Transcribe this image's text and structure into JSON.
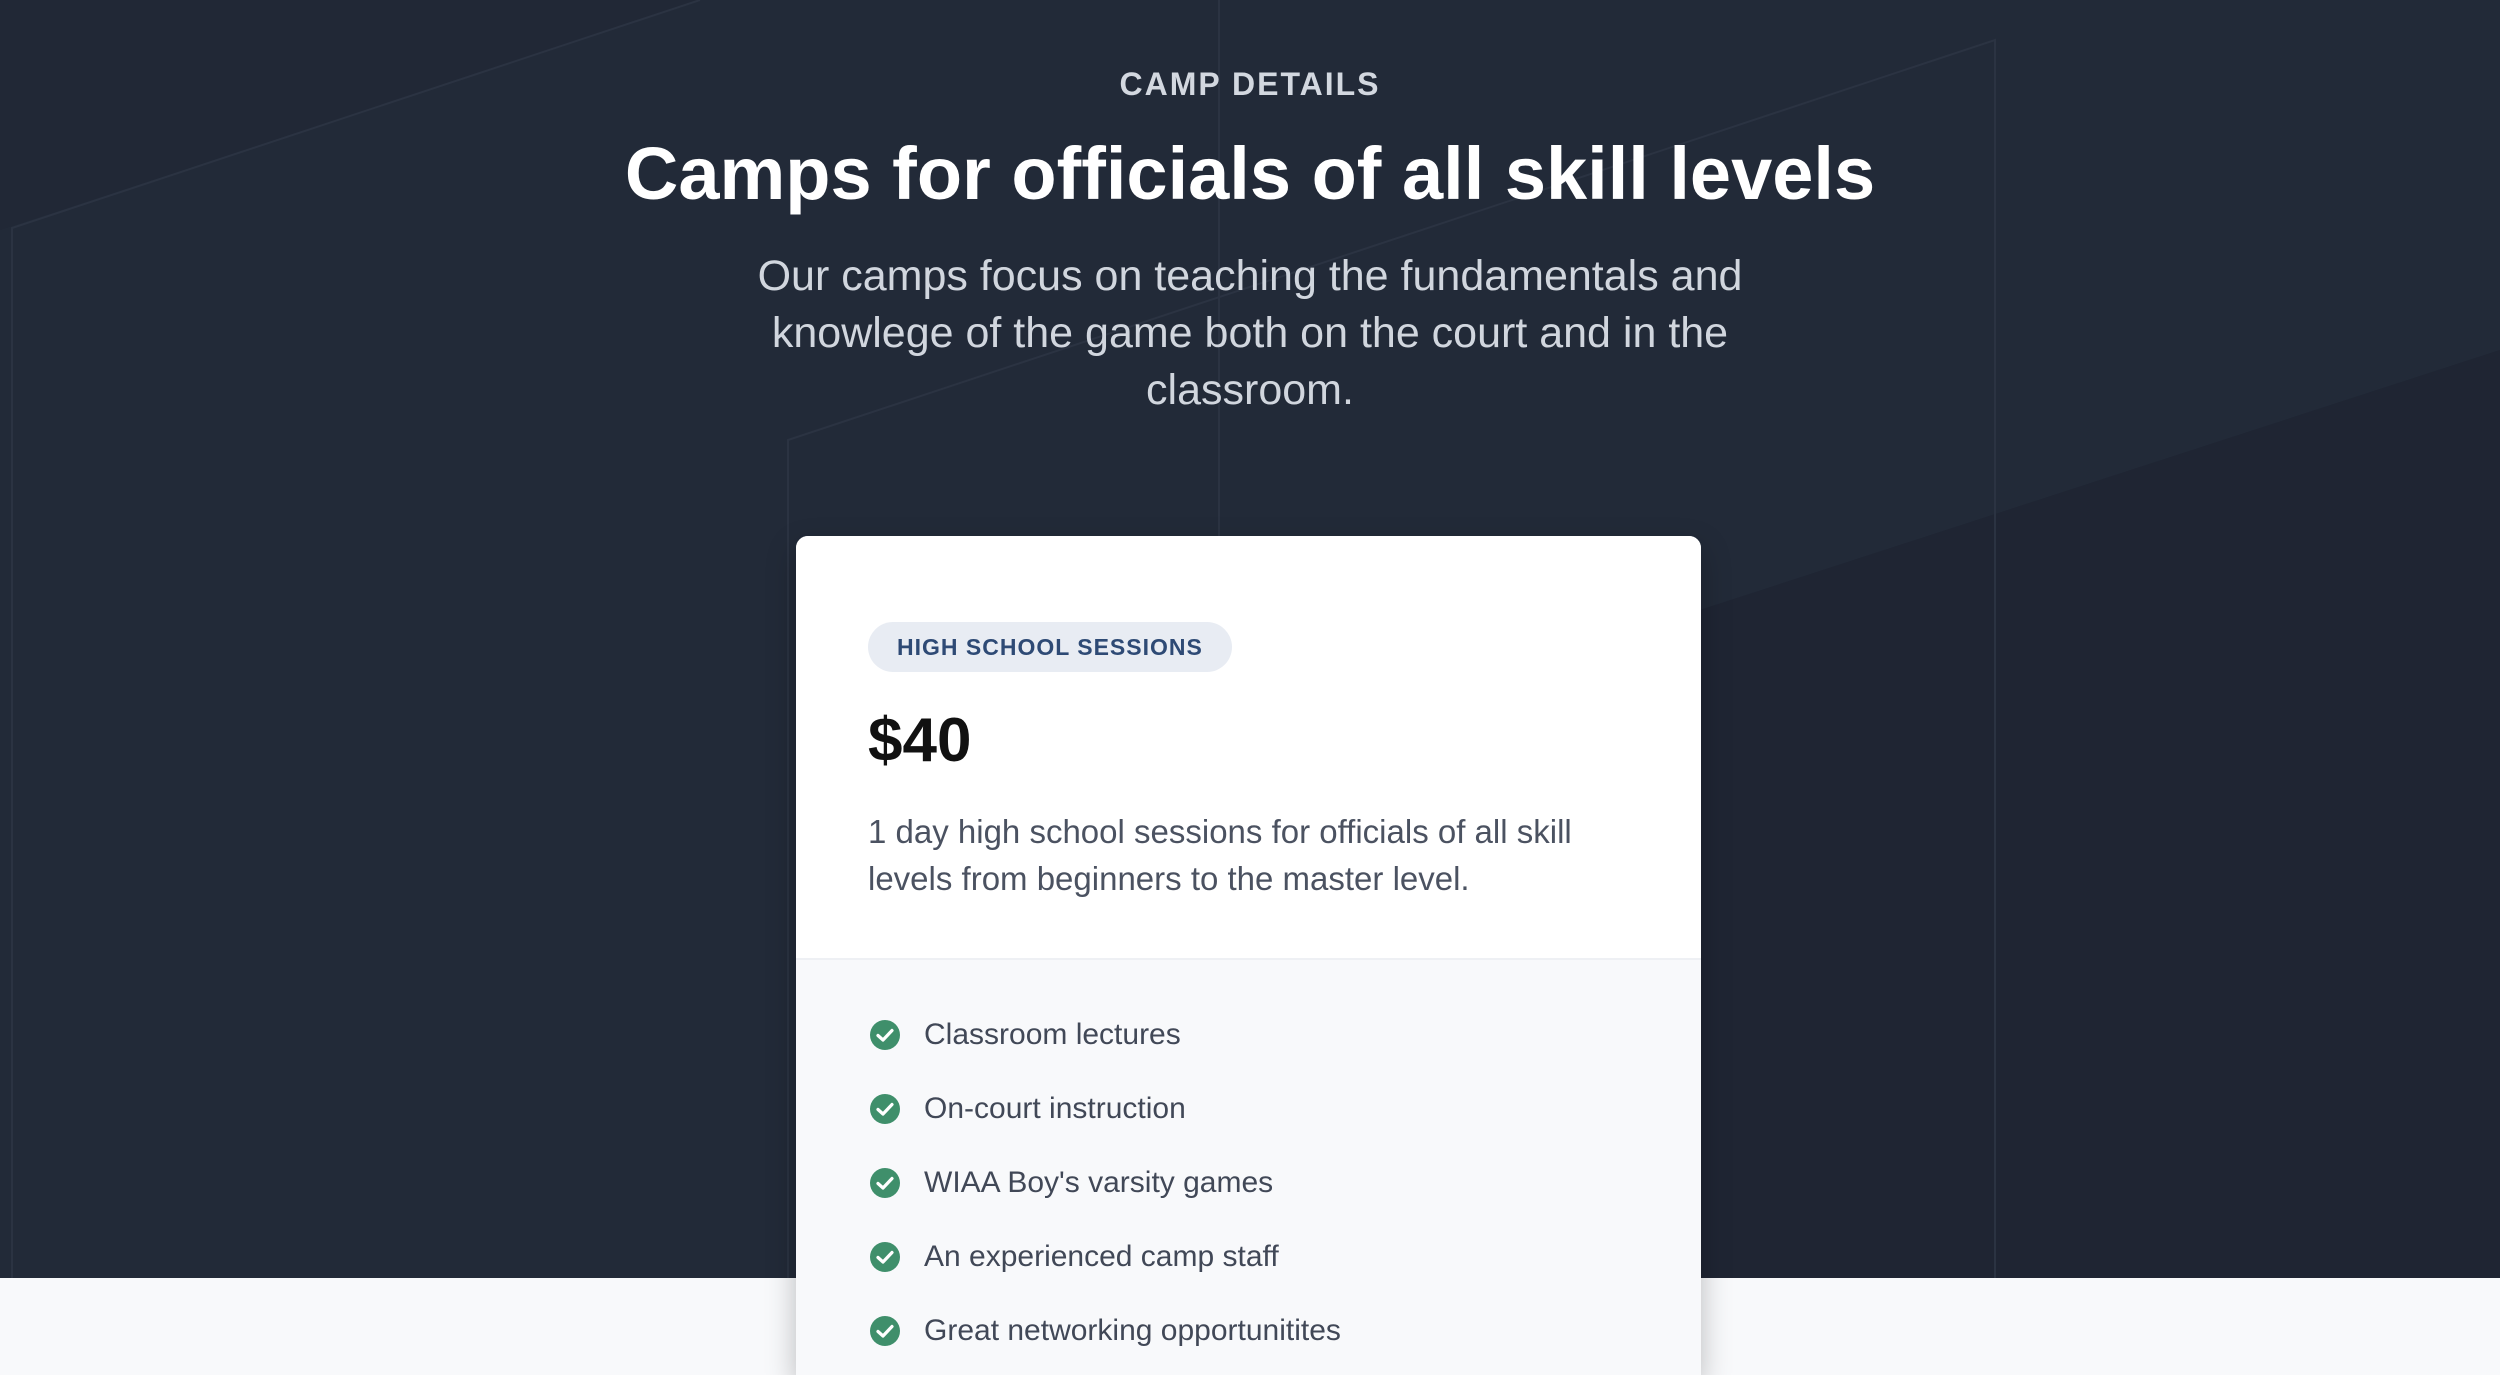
{
  "header": {
    "eyebrow": "CAMP DETAILS",
    "title": "Camps for officials of all skill levels",
    "subtitle": "Our camps focus on teaching the fundamentals and knowlege of the game both on the court and in the classroom."
  },
  "card": {
    "badge": "HIGH SCHOOL SESSIONS",
    "price": "$40",
    "description": "1 day high school sessions for officials of all skill levels from beginners to the master level.",
    "features": [
      "Classroom lectures",
      "On-court instruction",
      "WIAA Boy's varsity games",
      "An experienced camp staff",
      "Great networking opportunitites"
    ]
  },
  "icons": {
    "feature_icon": "check-circle-icon"
  },
  "colors": {
    "background": "#212836",
    "accent_check": "#3f8f6b",
    "badge_bg": "#e8ecf3",
    "badge_text": "#2e4a75"
  }
}
